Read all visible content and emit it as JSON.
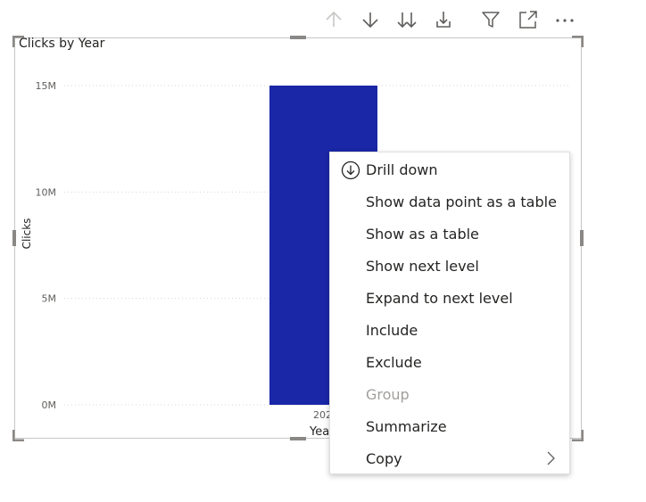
{
  "toolbar": {
    "icons": [
      "arrow-up-icon",
      "arrow-down-icon",
      "double-arrow-down-icon",
      "expand-hierarchy-icon",
      "filter-icon",
      "focus-mode-icon",
      "more-options-icon"
    ]
  },
  "visual": {
    "title": "Clicks by Year",
    "bar_color": "#1a27a7"
  },
  "chart_data": {
    "type": "bar",
    "title": "Clicks by Year",
    "xlabel": "Year",
    "ylabel": "Clicks",
    "categories": [
      "2020"
    ],
    "values": [
      15000000
    ],
    "ylim": [
      0,
      15000000
    ],
    "yticks": [
      "0M",
      "5M",
      "10M",
      "15M"
    ],
    "ytick_values": [
      0,
      5000000,
      10000000,
      15000000
    ],
    "xtick_visible": "202",
    "xlabel_visible": "Yea",
    "grid": true
  },
  "context_menu": {
    "items": [
      {
        "id": "drill-down",
        "label": "Drill down",
        "icon": "drill-down-icon",
        "enabled": true
      },
      {
        "id": "show-data-point-as-table",
        "label": "Show data point as a table",
        "enabled": true
      },
      {
        "id": "show-as-table",
        "label": "Show as a table",
        "enabled": true
      },
      {
        "id": "show-next-level",
        "label": "Show next level",
        "enabled": true
      },
      {
        "id": "expand-to-next-level",
        "label": "Expand to next level",
        "enabled": true
      },
      {
        "id": "include",
        "label": "Include",
        "enabled": true
      },
      {
        "id": "exclude",
        "label": "Exclude",
        "enabled": true
      },
      {
        "id": "group",
        "label": "Group",
        "enabled": false
      },
      {
        "id": "summarize",
        "label": "Summarize",
        "enabled": true
      },
      {
        "id": "copy",
        "label": "Copy",
        "icon": "chevron-right-icon",
        "enabled": true
      }
    ]
  }
}
